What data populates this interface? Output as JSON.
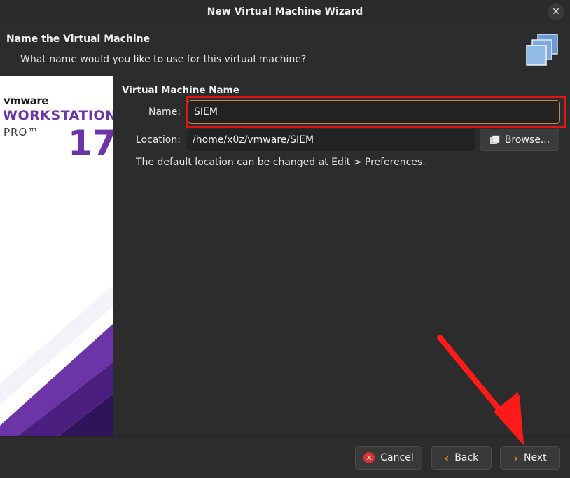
{
  "window": {
    "title": "New Virtual Machine Wizard",
    "close_icon": "close-icon"
  },
  "header": {
    "title": "Name the Virtual Machine",
    "subtitle": "What name would you like to use for this virtual machine?",
    "icon": "stacked-windows-icon"
  },
  "sidebar": {
    "brand": "vmware",
    "product": "WORKSTATION",
    "edition": "PRO™",
    "version": "17",
    "accent": "#6b35a8"
  },
  "form": {
    "section_title": "Virtual Machine Name",
    "name_label": "Name:",
    "name_value": "SIEM",
    "location_label": "Location:",
    "location_value": "/home/x0z/vmware/SIEM",
    "browse_label": "Browse...",
    "hint": "The default location can be changed at Edit > Preferences."
  },
  "footer": {
    "cancel_label": "Cancel",
    "back_label": "Back",
    "next_label": "Next"
  },
  "colors": {
    "background": "#2c2c2c",
    "highlight_box": "#e01515",
    "annotation_arrow": "#ff1a1a"
  }
}
